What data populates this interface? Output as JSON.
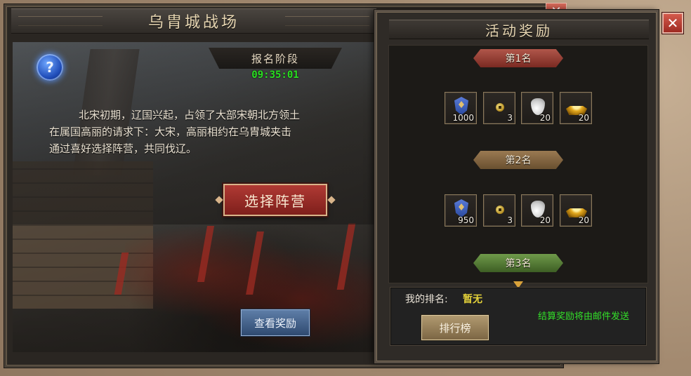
{
  "battlefield": {
    "title": "乌胄城战场",
    "phase": "报名阶段",
    "timer": "09:35:01",
    "help_glyph": "?",
    "story_lines": [
      "北宋初期，辽国兴起，占领了大部宋朝北方领土",
      "在属国高丽的请求下：大宋，高丽相约在乌胄城夹击",
      "通过喜好选择阵营，共同伐辽。"
    ],
    "choose_camp_label": "选择阵营",
    "view_rewards_label": "查看奖励"
  },
  "rewards_window": {
    "title": "活动奖励",
    "close_glyph": "✕",
    "ranks": [
      {
        "label": "第1名",
        "items": [
          {
            "icon": "shield-badge-icon",
            "count": "1000"
          },
          {
            "icon": "copper-coin-icon",
            "count": "3"
          },
          {
            "icon": "silver-pouch-icon",
            "count": "20"
          },
          {
            "icon": "gold-ingot-icon",
            "count": "20"
          }
        ]
      },
      {
        "label": "第2名",
        "items": [
          {
            "icon": "shield-badge-icon",
            "count": "950"
          },
          {
            "icon": "copper-coin-icon",
            "count": "3"
          },
          {
            "icon": "silver-pouch-icon",
            "count": "20"
          },
          {
            "icon": "gold-ingot-icon",
            "count": "20"
          }
        ]
      },
      {
        "label": "第3名",
        "items": []
      }
    ],
    "my_rank_label": "我的排名:",
    "my_rank_value": "暂无",
    "ranking_button_label": "排行榜",
    "mail_note": "结算奖励将由邮件发送"
  },
  "colors": {
    "timer_green": "#29e020",
    "rank_value_yellow": "#e6d33a",
    "note_green": "#33e029",
    "rank1_banner": "#9a3e34",
    "rank2_banner": "#84653f",
    "rank3_banner": "#557c36"
  }
}
